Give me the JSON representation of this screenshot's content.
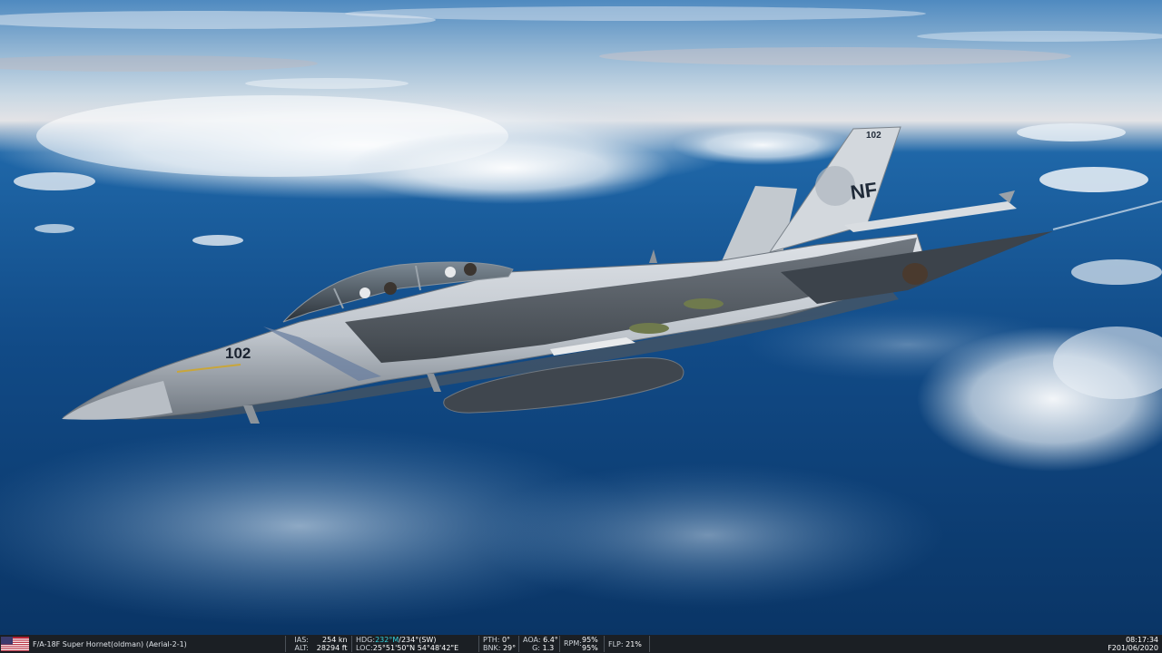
{
  "scene": {
    "description_icon": "fa18f-super-hornet",
    "tail_code": "NF",
    "modex": "102",
    "nose_number": "102"
  },
  "statusbar": {
    "flag_icon": "us-flag-icon",
    "aircraft": "F/A-18F Super Hornet(oldman) (Aerial-2-1)",
    "ias_label": "IAS:",
    "ias_value": "254 kn",
    "alt_label": "ALT:",
    "alt_value": "28294 ft",
    "hdg_label": "HDG:",
    "hdg_mag": "232°M",
    "hdg_true": "/234°(SW)",
    "loc_label": "LOC:",
    "loc_value": "25°51'50\"N 54°48'42\"E",
    "pth_label": "PTH:",
    "pth_value": "0°",
    "bnk_label": "BNK:",
    "bnk_value": "29°",
    "aoa_label": "AOA:",
    "aoa_value": "6.4°",
    "g_label": "G:",
    "g_value": "1.3",
    "rpm_label": "RPM:",
    "rpm_value_1": "95%",
    "rpm_value_2": "95%",
    "flp_label": "FLP:",
    "flp_value": "21%",
    "time": "08:17:34",
    "date": "F201/06/2020"
  },
  "colors": {
    "sky_top": "#3f7fb8",
    "ocean": "#0d3e74",
    "bar_bg": "#1b1f24",
    "heading_highlight": "#35d6e0",
    "aircraft_grey": "#c9ced4"
  }
}
